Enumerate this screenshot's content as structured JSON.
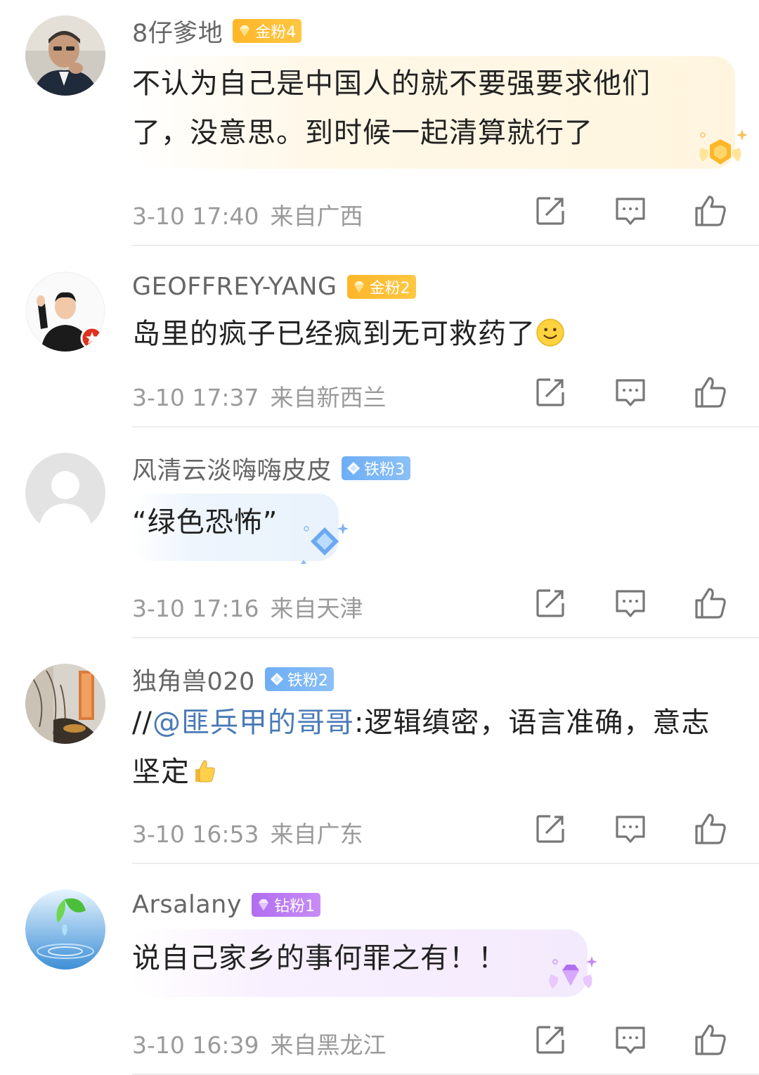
{
  "comments": [
    {
      "username": "8仔爹地",
      "badge": {
        "label": "金粉4",
        "tier": "gold"
      },
      "text": "不认为自己是中国人的就不要强要求他们了，没意思。到时候一起清算就行了",
      "time": "3-10 17:40",
      "location": "来自广西"
    },
    {
      "username": "GEOFFREY-YANG",
      "badge": {
        "label": "金粉2",
        "tier": "gold"
      },
      "text": "岛里的疯子已经疯到无可救药了",
      "emoji": "smile-emoji",
      "time": "3-10 17:37",
      "location": "来自新西兰"
    },
    {
      "username": "风清云淡嗨嗨皮皮",
      "badge": {
        "label": "铁粉3",
        "tier": "iron"
      },
      "text": "“绿色恐怖”",
      "time": "3-10 17:16",
      "location": "来自天津"
    },
    {
      "username": "独角兽020",
      "badge": {
        "label": "铁粉2",
        "tier": "iron"
      },
      "text_prefix": "//",
      "mention": "@匪兵甲的哥哥",
      "text_after_mention": ":逻辑缜密，语言准确，意志坚定",
      "emoji": "thumbs-up-emoji",
      "time": "3-10 16:53",
      "location": "来自广东"
    },
    {
      "username": "Arsalany",
      "badge": {
        "label": "钻粉1",
        "tier": "diamond"
      },
      "text": "说自己家乡的事何罪之有！！",
      "time": "3-10 16:39",
      "location": "来自黑龙江"
    }
  ],
  "icons": {
    "repost": "share-icon",
    "reply": "comment-icon",
    "like": "like-icon"
  },
  "colors": {
    "gold": "#ffb628",
    "iron": "#6eaef5",
    "diamond": "#b06ef0",
    "mention": "#4a7ab6",
    "meta": "#9a9a9a"
  }
}
